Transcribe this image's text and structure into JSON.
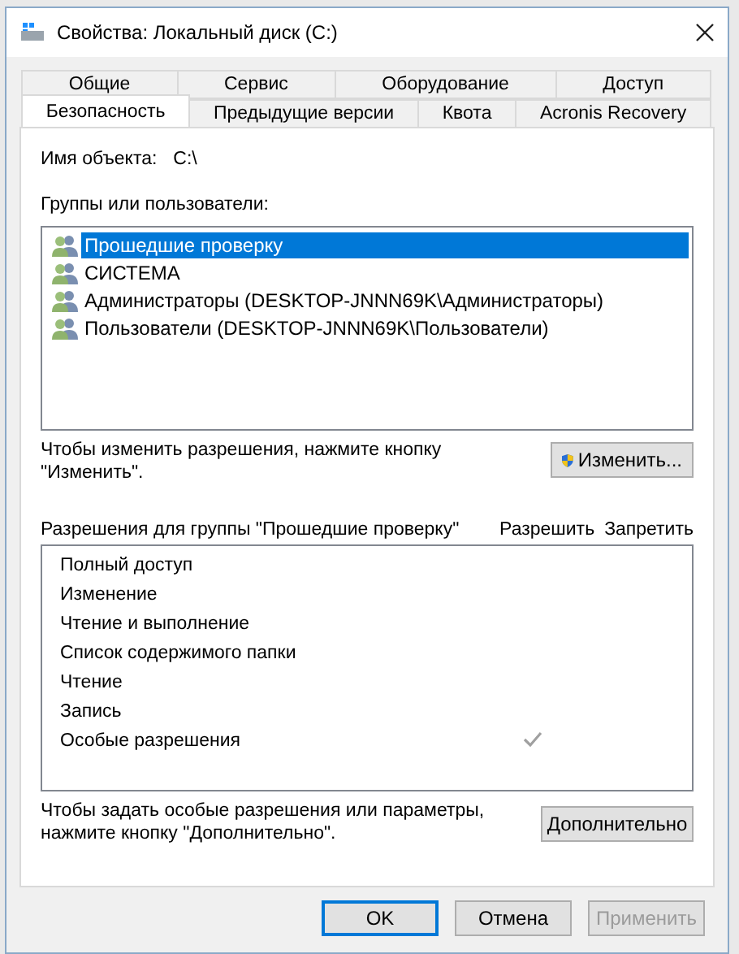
{
  "window": {
    "title": "Свойства: Локальный диск (C:)"
  },
  "tabs_top": [
    {
      "label": "Общие",
      "selected": false
    },
    {
      "label": "Сервис",
      "selected": false
    },
    {
      "label": "Оборудование",
      "selected": false
    },
    {
      "label": "Доступ",
      "selected": false
    }
  ],
  "tabs_bottom": [
    {
      "label": "Безопасность",
      "selected": true
    },
    {
      "label": "Предыдущие версии",
      "selected": false
    },
    {
      "label": "Квота",
      "selected": false
    },
    {
      "label": "Acronis Recovery",
      "selected": false
    }
  ],
  "object_name": {
    "label": "Имя объекта:",
    "value": "C:\\"
  },
  "groups": {
    "label": "Группы или пользователи:",
    "items": [
      {
        "name": "Прошедшие проверку",
        "selected": true
      },
      {
        "name": "СИСТЕМА",
        "selected": false
      },
      {
        "name": "Администраторы (DESKTOP-JNNN69K\\Администраторы)",
        "selected": false
      },
      {
        "name": "Пользователи (DESKTOP-JNNN69K\\Пользователи)",
        "selected": false
      }
    ]
  },
  "change_hint": "Чтобы изменить разрешения, нажмите кнопку \"Изменить\".",
  "change_button": "Изменить...",
  "permissions": {
    "label": "Разрешения для группы \"Прошедшие проверку\"",
    "allow_header": "Разрешить",
    "deny_header": "Запретить",
    "rows": [
      {
        "name": "Полный доступ",
        "allow": false,
        "deny": false
      },
      {
        "name": "Изменение",
        "allow": false,
        "deny": false
      },
      {
        "name": "Чтение и выполнение",
        "allow": false,
        "deny": false
      },
      {
        "name": "Список содержимого папки",
        "allow": false,
        "deny": false
      },
      {
        "name": "Чтение",
        "allow": false,
        "deny": false
      },
      {
        "name": "Запись",
        "allow": false,
        "deny": false
      },
      {
        "name": "Особые разрешения",
        "allow": true,
        "deny": false
      }
    ]
  },
  "advanced_hint": "Чтобы задать особые разрешения или параметры, нажмите кнопку \"Дополнительно\".",
  "advanced_button": "Дополнительно",
  "buttons": [
    {
      "label": "OK",
      "default": true,
      "disabled": false
    },
    {
      "label": "Отмена",
      "default": false,
      "disabled": false
    },
    {
      "label": "Применить",
      "default": false,
      "disabled": true
    }
  ]
}
